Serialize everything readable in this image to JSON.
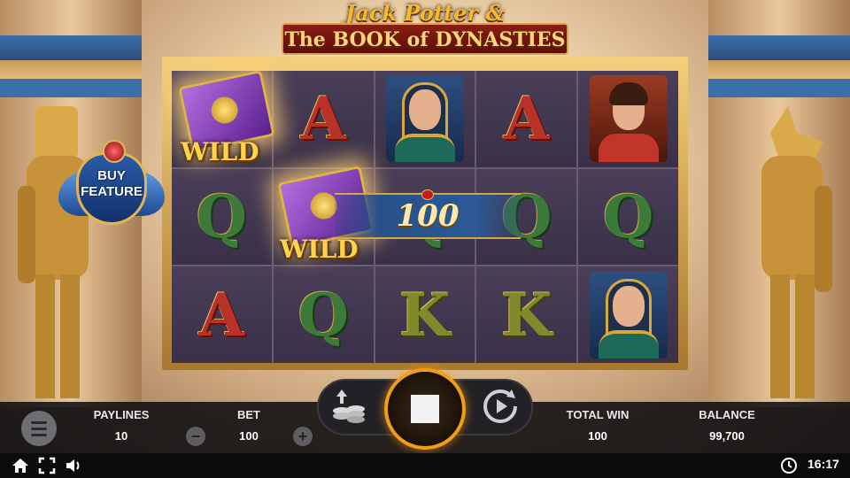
{
  "game": {
    "title_line1": "Jack Potter &",
    "title_line2": "The BOOK of DYNASTIES"
  },
  "reels": [
    [
      "WILD",
      "Q",
      "A"
    ],
    [
      "A",
      "WILD",
      "Q"
    ],
    [
      "Cleopatra",
      "Q",
      "K"
    ],
    [
      "A",
      "Q",
      "K"
    ],
    [
      "Jack Potter",
      "Q",
      "Cleopatra"
    ]
  ],
  "wild_label": "WILD",
  "win_banner": {
    "amount": "100"
  },
  "buy_feature": {
    "label_line1": "BUY",
    "label_line2": "FEATURE"
  },
  "bottom_bar": {
    "paylines_label": "PAYLINES",
    "paylines_value": "10",
    "bet_label": "BET",
    "bet_value": "100",
    "bet_decrease": "−",
    "bet_increase": "+",
    "total_win_label": "TOTAL WIN",
    "total_win_value": "100",
    "balance_label": "BALANCE",
    "balance_value": "99,700"
  },
  "footer": {
    "clock": "16:17"
  },
  "icons": [
    "menu-icon",
    "home-icon",
    "fullscreen-icon",
    "sound-icon",
    "coins-icon",
    "autoplay-icon",
    "stop-icon",
    "clock-icon"
  ],
  "colors": {
    "spin_ring": "#f39c1a",
    "banner_blue": "#2b5a96",
    "gold": "#e0b24a"
  }
}
